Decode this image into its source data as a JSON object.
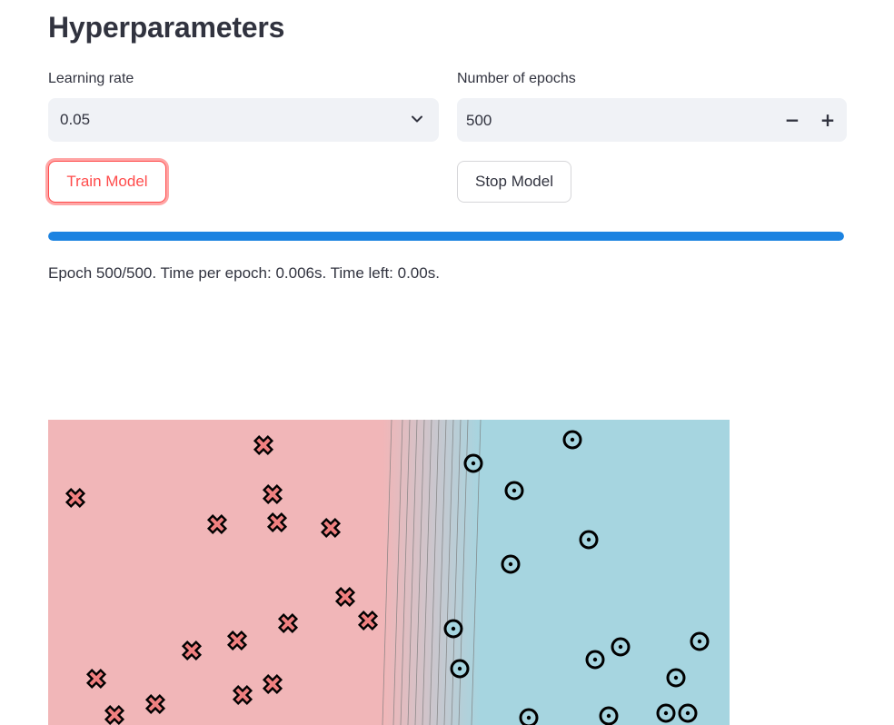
{
  "page": {
    "title": "Hyperparameters"
  },
  "learning_rate": {
    "label": "Learning rate",
    "selected": "0.05"
  },
  "epochs": {
    "label": "Number of epochs",
    "value": "500",
    "minus_symbol": "−",
    "plus_symbol": "+"
  },
  "buttons": {
    "train_label": "Train Model",
    "stop_label": "Stop Model"
  },
  "progress": {
    "fraction": 1.0,
    "color": "#1c83e1",
    "status_text": "Epoch 500/500. Time per epoch: 0.006s. Time left: 0.00s."
  },
  "chart_data": {
    "type": "scatter",
    "title": "",
    "xlabel": "",
    "ylabel": "",
    "grid": false,
    "xlim": [
      0,
      750
    ],
    "ylim": [
      0,
      336
    ],
    "regions": {
      "class_0_color": "#f1b6b8",
      "class_1_color": "#a6d5e0",
      "boundary_x_top": [
        378,
        390,
        398,
        406,
        414,
        422,
        430,
        438,
        446,
        454,
        462,
        476
      ],
      "boundary_x_bottom": [
        368,
        380,
        388,
        396,
        404,
        412,
        420,
        428,
        436,
        444,
        452,
        466
      ]
    },
    "series": [
      {
        "marker": "cross",
        "color": "#f08080",
        "points": [
          [
            237,
            28
          ],
          [
            30,
            86
          ],
          [
            247,
            82
          ],
          [
            186,
            115
          ],
          [
            252,
            113
          ],
          [
            311,
            119
          ],
          [
            327,
            195
          ],
          [
            352,
            221
          ],
          [
            264,
            224
          ],
          [
            208,
            243
          ],
          [
            158,
            254
          ],
          [
            53,
            285
          ],
          [
            247,
            291
          ],
          [
            214,
            303
          ],
          [
            118,
            313
          ],
          [
            73,
            325
          ]
        ]
      },
      {
        "marker": "circle",
        "color": "#a6d5e0",
        "points": [
          [
            577,
            22
          ],
          [
            468,
            48
          ],
          [
            513,
            78
          ],
          [
            595,
            132
          ],
          [
            509,
            159
          ],
          [
            446,
            230
          ],
          [
            630,
            250
          ],
          [
            717,
            244
          ],
          [
            602,
            264
          ],
          [
            453,
            274
          ],
          [
            691,
            284
          ],
          [
            529,
            328
          ],
          [
            617,
            326
          ],
          [
            680,
            323
          ],
          [
            704,
            323
          ]
        ]
      }
    ]
  }
}
